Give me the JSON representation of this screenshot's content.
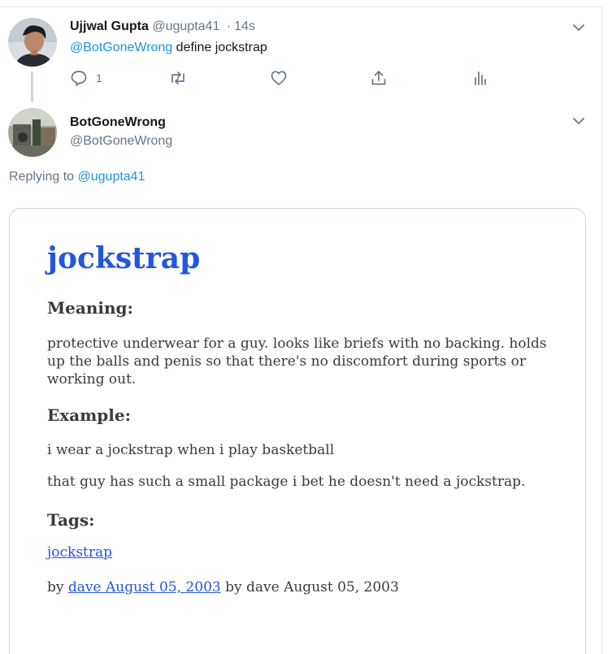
{
  "tweet1": {
    "display_name": "Ujjwal Gupta",
    "handle": "@ugupta41",
    "separator": "·",
    "time": "14s",
    "mention": "@BotGoneWrong",
    "text": " define jockstrap",
    "reply_count": "1"
  },
  "tweet2": {
    "display_name": "BotGoneWrong",
    "handle": "@BotGoneWrong",
    "replying_prefix": "Replying to ",
    "replying_handle": "@ugupta41"
  },
  "card": {
    "word": "jockstrap",
    "meaning_heading": "Meaning:",
    "meaning": "protective underwear for a guy. looks like briefs with no backing. holds up the balls and penis so that there's no discomfort during sports or working out.",
    "example_heading": "Example:",
    "examples": [
      "i wear a jockstrap when i play basketball",
      "that guy has such a small package i bet he doesn't need a jockstrap."
    ],
    "tags_heading": "Tags:",
    "tag": "jockstrap",
    "by_prefix": "by ",
    "by_link": "dave August 05, 2003",
    "by_suffix": " by dave August 05, 2003"
  },
  "colors": {
    "link": "#1b95e0",
    "card_link": "#2356e0",
    "muted": "#657786"
  },
  "icons": [
    "reply-icon",
    "retweet-icon",
    "like-icon",
    "share-icon",
    "analytics-icon",
    "chevron-down-icon"
  ]
}
